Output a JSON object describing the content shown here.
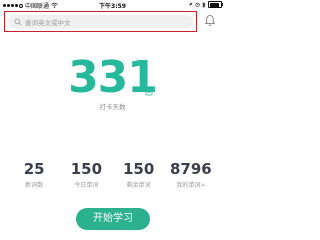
{
  "status_bar": {
    "carrier": "中国联通",
    "time": "下午3:59",
    "battery_percent": 0.8,
    "icons": [
      "signal-dots-icon",
      "wifi-icon",
      "location-icon",
      "alarm-icon",
      "bluetooth-icon",
      "battery-icon"
    ]
  },
  "search": {
    "placeholder": "查词英文或中文",
    "icon": "search-icon"
  },
  "header": {
    "notification_icon": "bell-icon"
  },
  "checkin": {
    "days": "331",
    "label": "打卡天数",
    "icon": "calendar-icon"
  },
  "stats": [
    {
      "value": "25",
      "label": "新词数"
    },
    {
      "value": "150",
      "label": "今日单词"
    },
    {
      "value": "150",
      "label": "剩余单词"
    },
    {
      "value": "8796",
      "label": "我的单词>"
    }
  ],
  "start_button": {
    "label": "开始学习"
  },
  "colors": {
    "accent": "#25b89a",
    "button": "#2bb18e",
    "highlight_border": "#c8202a"
  }
}
